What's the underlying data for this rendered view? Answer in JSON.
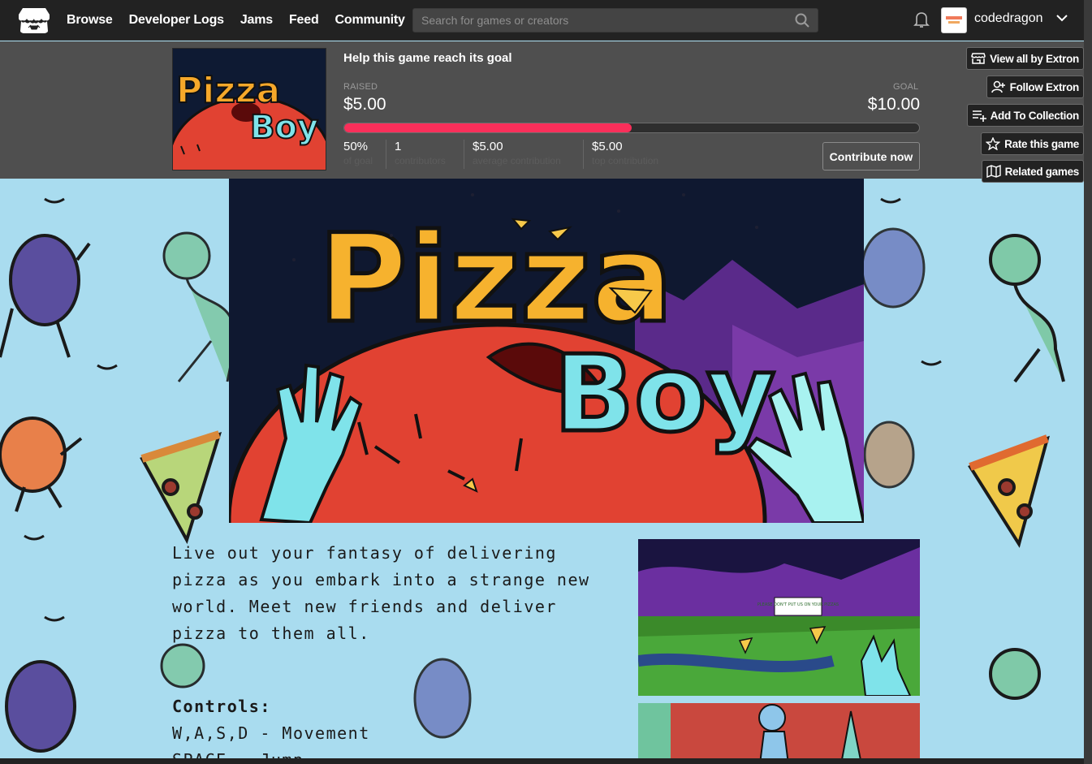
{
  "header": {
    "nav": [
      "Browse",
      "Developer Logs",
      "Jams",
      "Feed",
      "Community"
    ],
    "search_placeholder": "Search for games or creators",
    "username": "codedragon"
  },
  "goal": {
    "title": "Help this game reach its goal",
    "raised_label": "RAISED",
    "raised": "$5.00",
    "goal_label": "GOAL",
    "goal": "$10.00",
    "progress_fraction": 0.5,
    "stats": [
      {
        "value": "50%",
        "label": "of goal"
      },
      {
        "value": "1",
        "label": "contributors"
      },
      {
        "value": "$5.00",
        "label": "average contribution"
      },
      {
        "value": "$5.00",
        "label": "top contribution"
      }
    ],
    "contribute_label": "Contribute now"
  },
  "sidebar": {
    "view_all": "View all by Extron",
    "follow": "Follow Extron",
    "collection": "Add To Collection",
    "rate": "Rate this game",
    "related": "Related games"
  },
  "game": {
    "title_word1": "Pizza",
    "title_word2": "Boy",
    "description": "Live out your fantasy of delivering pizza as you embark into a strange new world. Meet new friends and deliver pizza to them all.",
    "controls_heading": "Controls:",
    "controls": [
      "W,A,S,D - Movement",
      "SPACE - Jump"
    ],
    "sign_text": "PLEASE DON'T PUT US ON YOUR PIZZAS"
  },
  "colors": {
    "page_bg": "#a9dcef",
    "header_bg": "#222222",
    "goal_panel_bg": "#4f4f4f",
    "progress_fill": "#fa2f5a"
  }
}
